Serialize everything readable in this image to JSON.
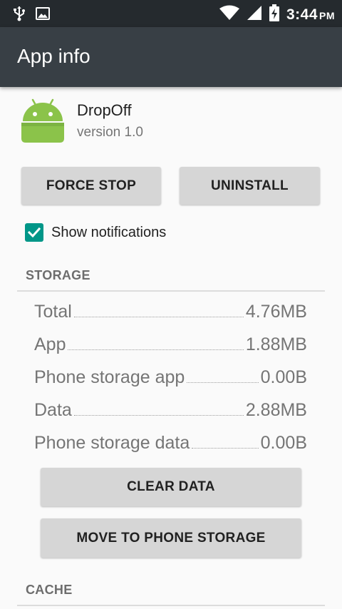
{
  "status_bar": {
    "time": "3:44",
    "ampm": "PM",
    "icons": [
      "usb-icon",
      "image-icon",
      "wifi-icon",
      "cell-signal-icon",
      "battery-charging-icon"
    ]
  },
  "app_bar": {
    "title": "App info"
  },
  "app": {
    "name": "DropOff",
    "version": "version 1.0",
    "icon": "android-icon"
  },
  "buttons": {
    "force_stop": "FORCE STOP",
    "uninstall": "UNINSTALL",
    "clear_data": "CLEAR DATA",
    "move_storage": "MOVE TO PHONE STORAGE"
  },
  "notifications": {
    "label": "Show notifications",
    "checked": true
  },
  "storage": {
    "header": "STORAGE",
    "rows": [
      {
        "label": "Total",
        "value": "4.76MB"
      },
      {
        "label": "App",
        "value": "1.88MB"
      },
      {
        "label": "Phone storage app",
        "value": "0.00B"
      },
      {
        "label": "Data",
        "value": "2.88MB"
      },
      {
        "label": "Phone storage data",
        "value": "0.00B"
      }
    ]
  },
  "cache": {
    "header": "CACHE"
  },
  "colors": {
    "accent": "#009688",
    "app_bar": "#383f45",
    "status_bar": "#252a2e",
    "android_green": "#8bc34a"
  }
}
